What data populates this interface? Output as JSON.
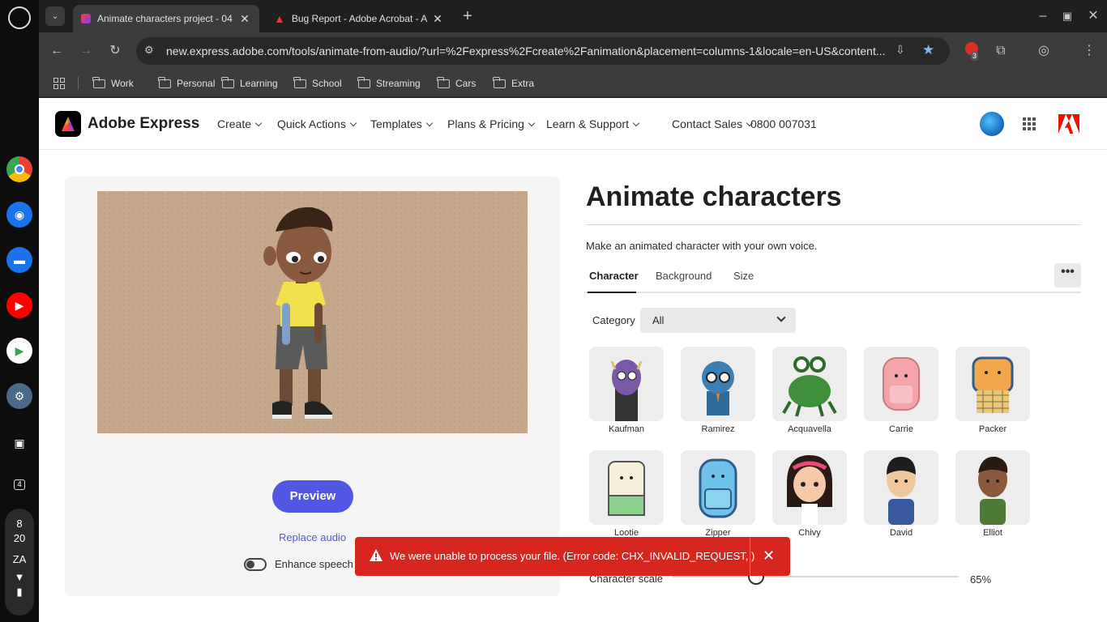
{
  "shelf": {
    "date_lines": [
      "8",
      "20"
    ],
    "locale": "ZA",
    "calendar_day": "4"
  },
  "tabs": [
    {
      "title": "Animate characters project - 04",
      "active": true
    },
    {
      "title": "Bug Report - Adobe Acrobat - A",
      "active": false
    }
  ],
  "toolbar": {
    "url": "new.express.adobe.com/tools/animate-from-audio/?url=%2Fexpress%2Fcreate%2Fanimation&placement=columns-1&locale=en-US&content...",
    "extension_badge": "3"
  },
  "bookmarks": [
    "Work",
    "Personal",
    "Learning",
    "School",
    "Streaming",
    "Cars",
    "Extra"
  ],
  "nav": {
    "brand": "Adobe Express",
    "items": [
      "Create",
      "Quick Actions",
      "Templates",
      "Plans & Pricing",
      "Learn & Support",
      "Contact Sales"
    ],
    "phone": "0800 007031"
  },
  "editor": {
    "preview_label": "Preview",
    "replace_audio": "Replace audio",
    "enhance_speech": "Enhance speech",
    "enhance_on": false
  },
  "panel": {
    "title": "Animate characters",
    "subtitle": "Make an animated character with your own voice.",
    "tabs": [
      "Character",
      "Background",
      "Size"
    ],
    "more_label": "•••",
    "category_label": "Category",
    "category_value": "All",
    "characters": [
      "Kaufman",
      "Ramirez",
      "Acquavella",
      "Carrie",
      "Packer",
      "Lootie",
      "Zipper",
      "Chivy",
      "David",
      "Elliot"
    ],
    "scale_label": "Character scale",
    "scale_value": "65%"
  },
  "toast": {
    "message": "We were unable to process your file. (Error code: CHX_INVALID_REQUEST, )"
  },
  "colors": {
    "accent": "#5258e4",
    "error": "#d7261e",
    "canvas_bg": "#c6a88d"
  }
}
